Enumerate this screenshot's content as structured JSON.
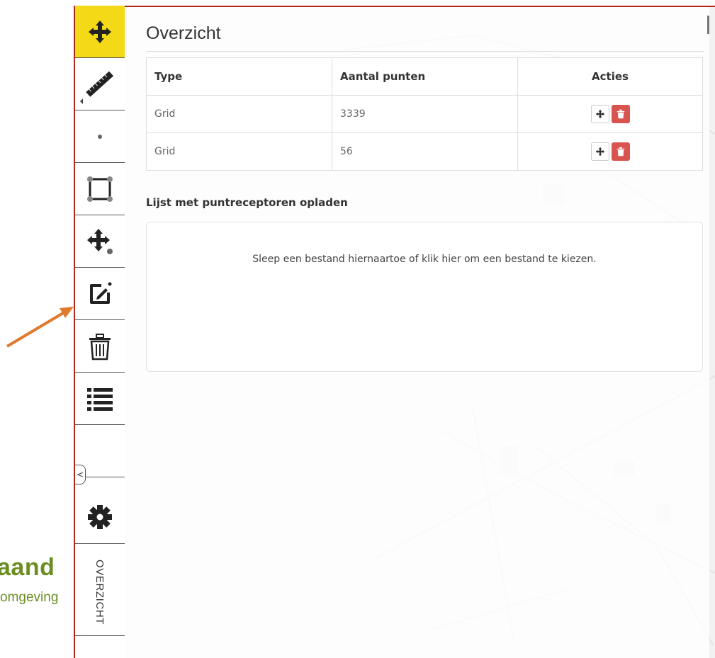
{
  "logo": {
    "main": "aand",
    "sub": "omgeving"
  },
  "toolbar": {
    "tools": [
      {
        "name": "pan",
        "icon": "move-icon",
        "active": true
      },
      {
        "name": "measure",
        "icon": "ruler-icon"
      },
      {
        "name": "point",
        "icon": "point-icon"
      },
      {
        "name": "rectangle",
        "icon": "polygon-icon"
      },
      {
        "name": "move-point",
        "icon": "move-point-icon"
      },
      {
        "name": "edit",
        "icon": "edit-icon"
      },
      {
        "name": "delete",
        "icon": "trash-icon"
      },
      {
        "name": "list",
        "icon": "list-icon"
      },
      {
        "name": "settings",
        "icon": "gear-icon"
      }
    ],
    "collapse_label": "<",
    "vertical_tab": "OVERZICHT"
  },
  "panel": {
    "title": "Overzicht",
    "table": {
      "headers": {
        "type": "Type",
        "points": "Aantal punten",
        "actions": "Acties"
      },
      "rows": [
        {
          "type": "Grid",
          "points": "3339"
        },
        {
          "type": "Grid",
          "points": "56"
        }
      ]
    },
    "upload_label": "Lijst met puntreceptoren opladen",
    "dropzone_text": "Sleep een bestand hiernaartoe of klik hier om een bestand te kiezen."
  },
  "colors": {
    "active_tool": "#f4d917",
    "delete": "#d9534f",
    "logo": "#6b8e23",
    "arrow": "#e07a2e"
  }
}
